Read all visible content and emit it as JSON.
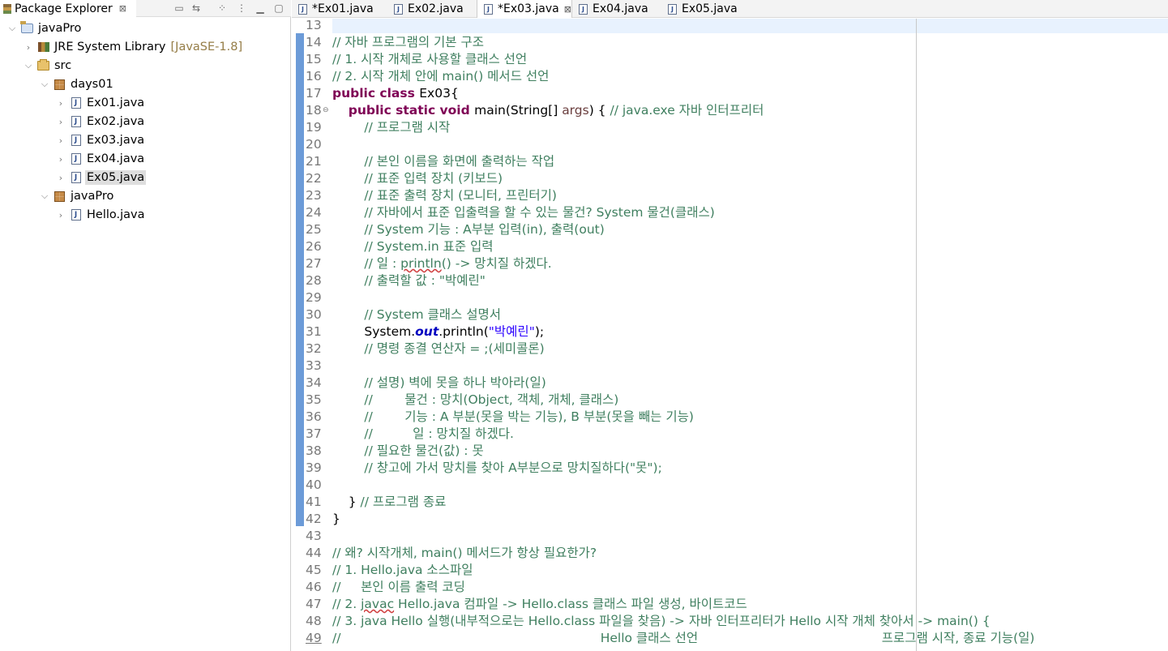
{
  "explorer": {
    "title": "Package Explorer",
    "close_glyph": "⊠",
    "toolbar_icons": [
      "collapse-all-icon",
      "link-with-editor-icon",
      "focus-icon",
      "view-menu-icon",
      "minimize-icon",
      "maximize-icon"
    ],
    "tree": [
      {
        "label": "javaPro",
        "icon": "project-icon",
        "expanded": true
      },
      {
        "label": "JRE System Library",
        "decoration": "[JavaSE-1.8]",
        "icon": "library-icon",
        "expanded": false
      },
      {
        "label": "src",
        "icon": "source-folder-icon",
        "expanded": true
      },
      {
        "label": "days01",
        "icon": "package-icon",
        "expanded": true
      },
      {
        "label": "Ex01.java",
        "icon": "java-file-icon",
        "expanded": false
      },
      {
        "label": "Ex02.java",
        "icon": "java-file-icon",
        "expanded": false
      },
      {
        "label": "Ex03.java",
        "icon": "java-file-icon",
        "expanded": false
      },
      {
        "label": "Ex04.java",
        "icon": "java-file-icon",
        "expanded": false
      },
      {
        "label": "Ex05.java",
        "icon": "java-file-icon",
        "expanded": false,
        "selected": true
      },
      {
        "label": "javaPro",
        "icon": "package-icon",
        "expanded": true
      },
      {
        "label": "Hello.java",
        "icon": "java-file-icon",
        "expanded": false
      }
    ]
  },
  "tabs": [
    {
      "label": "*Ex01.java",
      "active": false
    },
    {
      "label": "Ex02.java",
      "active": false
    },
    {
      "label": "*Ex03.java",
      "active": true,
      "close": "⊠"
    },
    {
      "label": "Ex04.java",
      "active": false
    },
    {
      "label": "Ex05.java",
      "active": false
    }
  ],
  "editor": {
    "lines": [
      {
        "n": "13",
        "segs": []
      },
      {
        "n": "14",
        "segs": [
          [
            "cm",
            "// 자바 프로그램의 기본 구조"
          ]
        ]
      },
      {
        "n": "15",
        "segs": [
          [
            "cm",
            "// 1. 시작 개체로 사용할 클래스 선언"
          ]
        ]
      },
      {
        "n": "16",
        "segs": [
          [
            "cm",
            "// 2. 시작 개체 안에 main() 메서드 선언"
          ]
        ]
      },
      {
        "n": "17",
        "segs": [
          [
            "kw",
            "public class "
          ],
          [
            "",
            "Ex03{"
          ]
        ]
      },
      {
        "n": "18",
        "fold": "⊖",
        "segs": [
          [
            "",
            "    "
          ],
          [
            "kw",
            "public static void "
          ],
          [
            "",
            "main(String[] "
          ],
          [
            "param",
            "args"
          ],
          [
            "",
            ") { "
          ],
          [
            "cm",
            "// java.exe 자바 인터프리터"
          ]
        ]
      },
      {
        "n": "19",
        "segs": [
          [
            "",
            "        "
          ],
          [
            "cm",
            "// 프로그램 시작"
          ]
        ]
      },
      {
        "n": "20",
        "segs": []
      },
      {
        "n": "21",
        "segs": [
          [
            "",
            "        "
          ],
          [
            "cm",
            "// 본인 이름을 화면에 출력하는 작업"
          ]
        ]
      },
      {
        "n": "22",
        "segs": [
          [
            "",
            "        "
          ],
          [
            "cm",
            "// 표준 입력 장치 (키보드)"
          ]
        ]
      },
      {
        "n": "23",
        "segs": [
          [
            "",
            "        "
          ],
          [
            "cm",
            "// 표준 출력 장치 (모니터, 프린터기)"
          ]
        ]
      },
      {
        "n": "24",
        "segs": [
          [
            "",
            "        "
          ],
          [
            "cm",
            "// 자바에서 표준 입출력을 할 수 있는 물건? System 물건(클래스)"
          ]
        ]
      },
      {
        "n": "25",
        "segs": [
          [
            "",
            "        "
          ],
          [
            "cm",
            "// System 기능 : A부분 입력(in), 출력(out)"
          ]
        ]
      },
      {
        "n": "26",
        "segs": [
          [
            "",
            "        "
          ],
          [
            "cm",
            "// System.in 표준 입력"
          ]
        ]
      },
      {
        "n": "27",
        "segs": [
          [
            "",
            "        "
          ],
          [
            "cm",
            "// 일 : "
          ],
          [
            "cm under",
            "println"
          ],
          [
            "cm",
            "() -> 망치질 하겠다."
          ]
        ]
      },
      {
        "n": "28",
        "segs": [
          [
            "",
            "        "
          ],
          [
            "cm",
            "// 출력할 값 : \"박예린\""
          ]
        ]
      },
      {
        "n": "29",
        "segs": []
      },
      {
        "n": "30",
        "segs": [
          [
            "",
            "        "
          ],
          [
            "cm",
            "// System 클래스 설명서"
          ]
        ]
      },
      {
        "n": "31",
        "segs": [
          [
            "",
            "        System."
          ],
          [
            "fld",
            "out"
          ],
          [
            "",
            ".println("
          ],
          [
            "str",
            "\"박예린\""
          ],
          [
            "",
            ");"
          ]
        ]
      },
      {
        "n": "32",
        "segs": [
          [
            "",
            "        "
          ],
          [
            "cm",
            "// 명령 종결 연산자 = ;(세미콜론)"
          ]
        ]
      },
      {
        "n": "33",
        "segs": []
      },
      {
        "n": "34",
        "segs": [
          [
            "",
            "        "
          ],
          [
            "cm",
            "// 설명) 벽에 못을 하나 박아라(일)"
          ]
        ]
      },
      {
        "n": "35",
        "segs": [
          [
            "",
            "        "
          ],
          [
            "cm",
            "//        물건 : 망치(Object, 객체, 개체, 클래스)"
          ]
        ]
      },
      {
        "n": "36",
        "segs": [
          [
            "",
            "        "
          ],
          [
            "cm",
            "//        기능 : A 부분(못을 박는 기능), B 부분(못을 빼는 기능)"
          ]
        ]
      },
      {
        "n": "37",
        "segs": [
          [
            "",
            "        "
          ],
          [
            "cm",
            "//          일 : 망치질 하겠다."
          ]
        ]
      },
      {
        "n": "38",
        "segs": [
          [
            "",
            "        "
          ],
          [
            "cm",
            "// 필요한 물건(값) : 못"
          ]
        ]
      },
      {
        "n": "39",
        "segs": [
          [
            "",
            "        "
          ],
          [
            "cm",
            "// 창고에 가서 망치를 찾아 A부분으로 망치질하다(\"못\");"
          ]
        ]
      },
      {
        "n": "40",
        "segs": []
      },
      {
        "n": "41",
        "segs": [
          [
            "",
            "    } "
          ],
          [
            "cm",
            "// 프로그램 종료"
          ]
        ]
      },
      {
        "n": "42",
        "segs": [
          [
            "",
            "}"
          ]
        ]
      },
      {
        "n": "43",
        "segs": []
      },
      {
        "n": "44",
        "segs": [
          [
            "cm",
            "// 왜? 시작개체, main() 메서드가 항상 필요한가?"
          ]
        ]
      },
      {
        "n": "45",
        "segs": [
          [
            "cm",
            "// 1. Hello.java 소스파일"
          ]
        ]
      },
      {
        "n": "46",
        "segs": [
          [
            "cm",
            "//     본인 이름 출력 코딩"
          ]
        ]
      },
      {
        "n": "47",
        "segs": [
          [
            "cm",
            "// 2. "
          ],
          [
            "cm under",
            "javac"
          ],
          [
            "cm",
            " Hello.java 컴파일 -> Hello.class 클래스 파일 생성, 바이트코드"
          ]
        ]
      },
      {
        "n": "48",
        "segs": [
          [
            "cm",
            "// 3. java Hello 실행(내부적으로는 Hello.class 파일을 찾음) -> 자바 인터프리터가 Hello 시작 개체 찾아서 -> main() {"
          ]
        ]
      },
      {
        "n": "49",
        "segs": [
          [
            "cm",
            "//                                                                 Hello 클래스 선언                                              프로그램 시작, 종료 기능(일)"
          ]
        ]
      }
    ]
  }
}
